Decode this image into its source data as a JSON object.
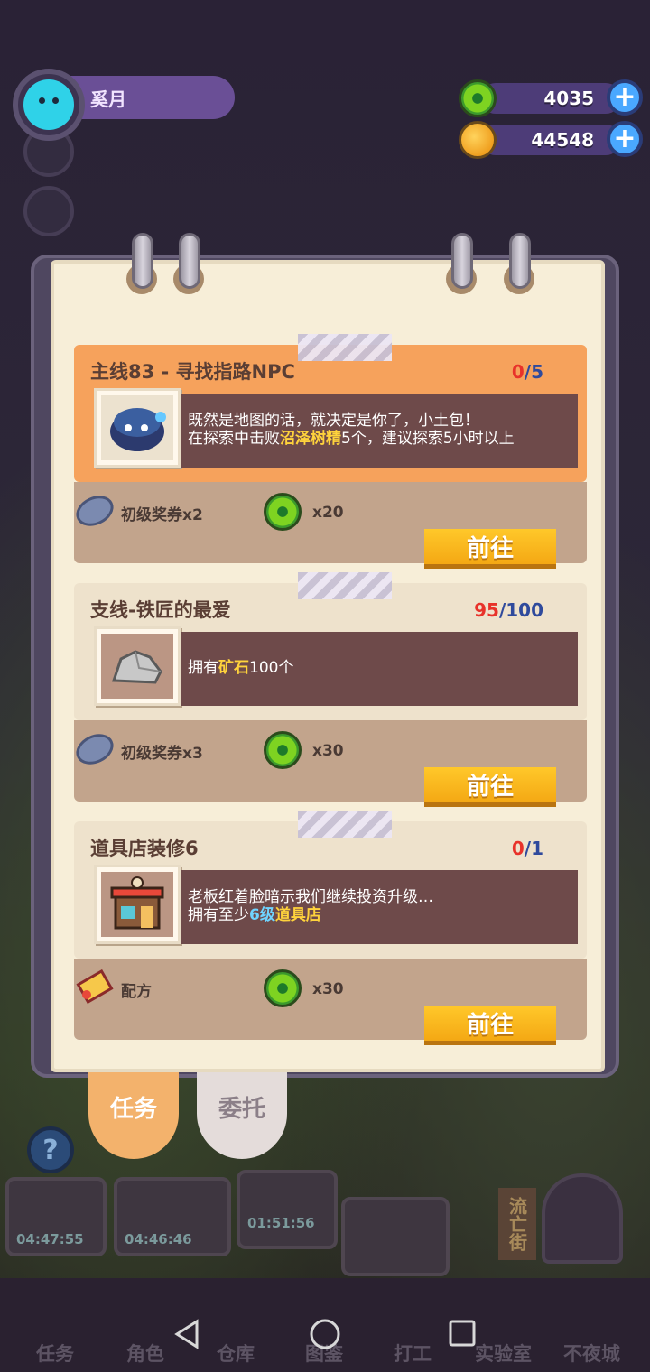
{
  "hud": {
    "player_name": "奚月",
    "currency_green": "4035",
    "currency_planet": "44548"
  },
  "quests": [
    {
      "title": "主线83 - 寻找指路NPC",
      "progress_current": "0",
      "progress_sep": "/",
      "progress_max": "5",
      "desc_line1": "既然是地图的话，就决定是你了，小土包！",
      "desc_line2_pre": "在探索中击败",
      "desc_line2_hl": "沼泽树精",
      "desc_line2_post": "5个，建议探索5小时以上",
      "reward1_label": "初级奖券x2",
      "reward2_label": "x20",
      "button": "前往"
    },
    {
      "title": "支线-铁匠的最爱",
      "progress_current": "95",
      "progress_sep": "/",
      "progress_max": "100",
      "desc_pre": "拥有",
      "desc_hl": "矿石",
      "desc_post": "100个",
      "reward1_label": "初级奖券x3",
      "reward2_label": "x30",
      "button": "前往"
    },
    {
      "title": "道具店装修6",
      "progress_current": "0",
      "progress_sep": "/",
      "progress_max": "1",
      "desc_line1": "老板红着脸暗示我们继续投资升级…",
      "desc_line2_pre": "拥有至少",
      "desc_line2_hl_blue": "6级",
      "desc_line2_hl_yellow": "道具店",
      "reward1_label": "配方",
      "reward2_label": "x30",
      "button": "前往"
    }
  ],
  "tabs": {
    "task": "任务",
    "commission": "委托"
  },
  "timers": [
    "04:47:55",
    "04:46:46",
    "01:51:56"
  ],
  "side_sign": "流亡街",
  "bottom_nav": [
    "任务",
    "角色",
    "仓库",
    "图鉴",
    "打工",
    "实验室",
    "不夜城"
  ],
  "colors": {
    "accent_orange": "#f6a25c",
    "button_yellow": "#ffc82a",
    "progress_red": "#e8322a",
    "progress_blue": "#2f4a9c",
    "highlight_yellow": "#ffd33c",
    "highlight_blue": "#6fd4ff"
  }
}
